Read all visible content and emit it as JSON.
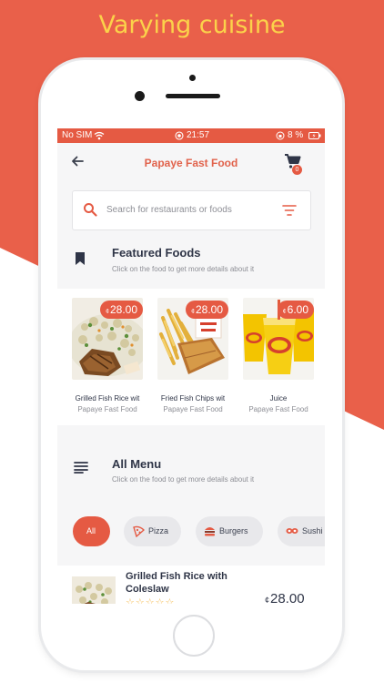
{
  "promo_title": "Varying cuisine",
  "status_bar": {
    "carrier": "No SIM",
    "time": "21:57",
    "battery": "8 %"
  },
  "header": {
    "title": "Papaye Fast Food",
    "cart_count": "0"
  },
  "search": {
    "placeholder": "Search for restaurants or foods"
  },
  "featured": {
    "title": "Featured Foods",
    "subtitle": "Click on the food to get more details about it",
    "items": [
      {
        "name": "Grilled Fish Rice wit",
        "restaurant": "Papaye Fast Food",
        "currency": "¢",
        "price": "28.00"
      },
      {
        "name": "Fried Fish Chips wit",
        "restaurant": "Papaye Fast Food",
        "currency": "¢",
        "price": "28.00"
      },
      {
        "name": "Juice",
        "restaurant": "Papaye Fast Food",
        "currency": "¢",
        "price": "6.00"
      }
    ]
  },
  "all_menu": {
    "title": "All Menu",
    "subtitle": "Click on the food to get more details about it",
    "categories": [
      "All",
      "Pizza",
      "Burgers",
      "Sushi"
    ]
  },
  "menu_items": [
    {
      "name": "Grilled Fish Rice with Coleslaw",
      "stars": "☆☆☆☆☆",
      "currency": "¢",
      "price": "28.00"
    }
  ],
  "colors": {
    "accent": "#e55a43",
    "title_text": "#2f3547",
    "promo_yellow": "#fbd24a"
  }
}
